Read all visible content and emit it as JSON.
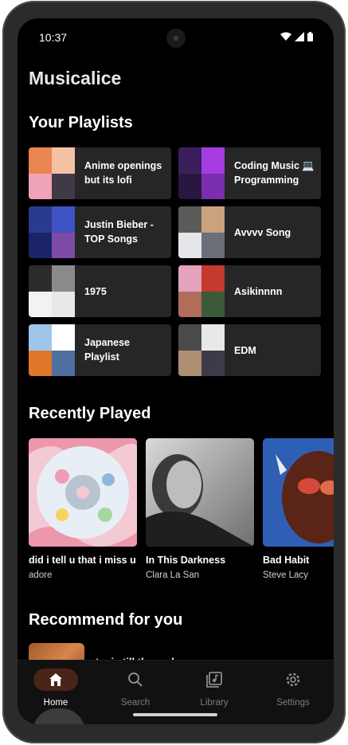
{
  "status_bar": {
    "time": "10:37"
  },
  "app": {
    "title": "Musicalice"
  },
  "playlists": {
    "heading": "Your Playlists",
    "items": [
      {
        "name": "Anime openings but its lofi",
        "art": [
          "#e9854f",
          "#f4c1a5",
          "#f0a3b8",
          "#3f3a46"
        ]
      },
      {
        "name": "Coding Music 💻 Programming",
        "art": [
          "#3b1f5c",
          "#a53ce0",
          "#2a1740",
          "#7a2fb0"
        ]
      },
      {
        "name": "Justin Bieber - TOP Songs",
        "art": [
          "#2a3b8f",
          "#4053c4",
          "#1b2466",
          "#7e4aa8"
        ]
      },
      {
        "name": "Avvvv Song",
        "art": [
          "#5a5a5a",
          "#c9a27e",
          "#e4e6ea",
          "#6a6f78"
        ]
      },
      {
        "name": "1975",
        "art": [
          "#2c2c2c",
          "#8a8a8a",
          "#f2f2f2",
          "#e8e8e8"
        ]
      },
      {
        "name": "Asikinnnn",
        "art": [
          "#e3a3bf",
          "#c43a2c",
          "#b36b5a",
          "#3a5a3a"
        ]
      },
      {
        "name": "Japanese Playlist",
        "art": [
          "#9fc6e8",
          "#ffffff",
          "#e0762a",
          "#4f6fa0"
        ]
      },
      {
        "name": "EDM",
        "art": [
          "#4a4a4a",
          "#e8e8e8",
          "#ad8f74",
          "#3f3a4a"
        ]
      }
    ]
  },
  "recently_played": {
    "heading": "Recently Played",
    "items": [
      {
        "title": "did i tell u that i miss u",
        "artist": "adore"
      },
      {
        "title": "In This Darkness",
        "artist": "Clara La San"
      },
      {
        "title": "Bad Habit",
        "artist": "Steve Lacy"
      }
    ]
  },
  "recommend": {
    "heading": "Recommend for you",
    "first_title": "toxic till the end"
  },
  "nav": {
    "home": "Home",
    "search": "Search",
    "library": "Library",
    "settings": "Settings"
  },
  "colors": {
    "background": "#000000",
    "card": "#262626",
    "accent_pill": "#4a2418"
  }
}
